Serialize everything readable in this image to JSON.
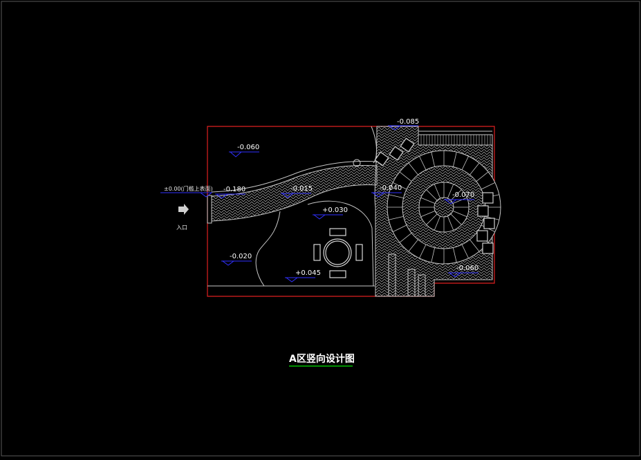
{
  "drawing": {
    "title": "A区竖向设计图",
    "entrance_label": "入口",
    "origin_label": "±0.00(门槛上表面)",
    "elevations": [
      "-0.085",
      "-0.060",
      "-0.180",
      "-0.015",
      "-0.040",
      "-0.070",
      "+0.030",
      "-0.020",
      "+0.045",
      "-0.060"
    ]
  },
  "colors": {
    "background": "#000000",
    "boundary": "#e02020",
    "linework": "#c8c8c8",
    "markers": "#3030ff",
    "title_underline": "#00c000"
  }
}
